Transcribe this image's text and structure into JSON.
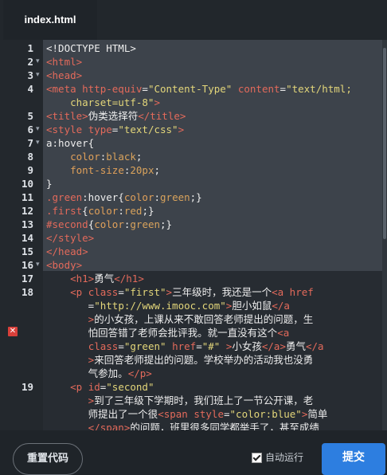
{
  "tab": {
    "label": "index.html"
  },
  "lines": [
    {
      "num": "1",
      "fold": "",
      "segs": [
        [
          "w",
          "<!DOCTYPE HTML>"
        ]
      ]
    },
    {
      "num": "2",
      "fold": "▾",
      "segs": [
        [
          "t",
          "<html>"
        ]
      ]
    },
    {
      "num": "3",
      "fold": "▾",
      "segs": [
        [
          "t",
          "<head>"
        ]
      ]
    },
    {
      "num": "4",
      "fold": "",
      "segs": [
        [
          "t",
          "<meta "
        ],
        [
          "a",
          "http-equiv"
        ],
        [
          "w",
          "="
        ],
        [
          "s",
          "\"Content-Type\""
        ],
        [
          "w",
          " "
        ],
        [
          "a",
          "content"
        ],
        [
          "w",
          "="
        ],
        [
          "s",
          "\"text/html;"
        ]
      ]
    },
    {
      "num": "",
      "fold": "",
      "segs": [
        [
          "s",
          "    charset=utf-8\""
        ],
        [
          "t",
          ">"
        ]
      ]
    },
    {
      "num": "5",
      "fold": "",
      "segs": [
        [
          "t",
          "<title>"
        ],
        [
          "w",
          "伪类选择符"
        ],
        [
          "t",
          "</title>"
        ]
      ]
    },
    {
      "num": "6",
      "fold": "▾",
      "segs": [
        [
          "t",
          "<style "
        ],
        [
          "a",
          "type"
        ],
        [
          "w",
          "="
        ],
        [
          "s",
          "\"text/css\""
        ],
        [
          "t",
          ">"
        ]
      ]
    },
    {
      "num": "7",
      "fold": "▾",
      "segs": [
        [
          "w",
          "a:hover{"
        ]
      ]
    },
    {
      "num": "8",
      "fold": "",
      "segs": [
        [
          "w",
          "    "
        ],
        [
          "p",
          "color"
        ],
        [
          "w",
          ":"
        ],
        [
          "n",
          "black"
        ],
        [
          "w",
          ";"
        ]
      ]
    },
    {
      "num": "9",
      "fold": "",
      "segs": [
        [
          "w",
          "    "
        ],
        [
          "p",
          "font-size"
        ],
        [
          "w",
          ":"
        ],
        [
          "n",
          "20px"
        ],
        [
          "w",
          ";"
        ]
      ]
    },
    {
      "num": "10",
      "fold": "",
      "segs": [
        [
          "w",
          "}"
        ]
      ]
    },
    {
      "num": "11",
      "fold": "",
      "segs": [
        [
          "t",
          ".green"
        ],
        [
          "w",
          ":hover{"
        ],
        [
          "p",
          "color"
        ],
        [
          "w",
          ":"
        ],
        [
          "n",
          "green"
        ],
        [
          "w",
          ";}"
        ]
      ]
    },
    {
      "num": "12",
      "fold": "",
      "segs": [
        [
          "t",
          ".first"
        ],
        [
          "w",
          "{"
        ],
        [
          "p",
          "color"
        ],
        [
          "w",
          ":"
        ],
        [
          "n",
          "red"
        ],
        [
          "w",
          ";}"
        ]
      ]
    },
    {
      "num": "13",
      "fold": "",
      "segs": [
        [
          "t",
          "#second"
        ],
        [
          "w",
          "{"
        ],
        [
          "p",
          "color"
        ],
        [
          "w",
          ":"
        ],
        [
          "n",
          "green"
        ],
        [
          "w",
          ";}"
        ]
      ]
    },
    {
      "num": "14",
      "fold": "",
      "segs": [
        [
          "t",
          "</style>"
        ]
      ]
    },
    {
      "num": "15",
      "fold": "",
      "segs": [
        [
          "t",
          "</head>"
        ]
      ]
    },
    {
      "num": "16",
      "fold": "▾",
      "segs": [
        [
          "t",
          "<body>"
        ]
      ]
    },
    {
      "num": "17",
      "fold": "",
      "segs": [
        [
          "w",
          "    "
        ],
        [
          "t",
          "<h1>"
        ],
        [
          "w",
          "勇气"
        ],
        [
          "t",
          "</h1>"
        ]
      ]
    },
    {
      "num": "18",
      "fold": "",
      "segs": [
        [
          "w",
          "    "
        ],
        [
          "t",
          "<p "
        ],
        [
          "a",
          "class"
        ],
        [
          "w",
          "="
        ],
        [
          "s",
          "\"first\""
        ],
        [
          "t",
          ">"
        ],
        [
          "w",
          "三年级时，我还是一个"
        ],
        [
          "t",
          "<a "
        ],
        [
          "a",
          "href"
        ]
      ]
    },
    {
      "num": "",
      "fold": "",
      "segs": [
        [
          "w",
          "       ="
        ],
        [
          "s",
          "\"http://www.imooc.com\""
        ],
        [
          "t",
          ">"
        ],
        [
          "w",
          "胆小如鼠"
        ],
        [
          "t",
          "</a"
        ]
      ]
    },
    {
      "num": "",
      "fold": "",
      "segs": [
        [
          "t",
          "       >"
        ],
        [
          "w",
          "的小女孩，上课从来不敢回答老师提出的问题，生"
        ]
      ]
    },
    {
      "num": "",
      "fold": "",
      "segs": [
        [
          "w",
          "       怕回答错了老师会批评我。就一直没有这个"
        ],
        [
          "t",
          "<a"
        ]
      ]
    },
    {
      "num": "",
      "fold": "",
      "segs": [
        [
          "w",
          "       "
        ],
        [
          "a",
          "class"
        ],
        [
          "w",
          "="
        ],
        [
          "s",
          "\"green\""
        ],
        [
          "w",
          " "
        ],
        [
          "a",
          "href"
        ],
        [
          "w",
          "="
        ],
        [
          "s",
          "\"#\""
        ],
        [
          "w",
          " "
        ],
        [
          "t",
          ">"
        ],
        [
          "w",
          "小女孩"
        ],
        [
          "t",
          "</a>"
        ],
        [
          "w",
          "勇气"
        ],
        [
          "t",
          "</a"
        ]
      ]
    },
    {
      "num": "",
      "fold": "",
      "segs": [
        [
          "t",
          "       >"
        ],
        [
          "w",
          "来回答老师提出的问题。学校举办的活动我也没勇"
        ]
      ]
    },
    {
      "num": "",
      "fold": "",
      "segs": [
        [
          "w",
          "       气参加。"
        ],
        [
          "t",
          "</p>"
        ]
      ]
    },
    {
      "num": "19",
      "fold": "",
      "segs": [
        [
          "w",
          "    "
        ],
        [
          "t",
          "<p "
        ],
        [
          "a",
          "id"
        ],
        [
          "w",
          "="
        ],
        [
          "s",
          "\"second\""
        ]
      ]
    },
    {
      "num": "",
      "fold": "",
      "segs": [
        [
          "t",
          "       >"
        ],
        [
          "w",
          "到了三年级下学期时，我们班上了一节公开课，老"
        ]
      ]
    },
    {
      "num": "",
      "fold": "",
      "segs": [
        [
          "w",
          "       师提出了一个很"
        ],
        [
          "t",
          "<span "
        ],
        [
          "a",
          "style"
        ],
        [
          "w",
          "="
        ],
        [
          "s",
          "\"color:blue\""
        ],
        [
          "t",
          ">"
        ],
        [
          "w",
          "简单"
        ]
      ]
    },
    {
      "num": "",
      "fold": "",
      "segs": [
        [
          "t",
          "       </span>"
        ],
        [
          "w",
          "的问题，班里很多同学都举手了，甚至成绩"
        ]
      ]
    }
  ],
  "footer": {
    "reset_label": "重置代码",
    "auto_run_label": "自动运行",
    "submit_label": "提交"
  },
  "colors": {
    "tag": "#e36a5b",
    "string": "#e3d67a",
    "property": "#e0a05a",
    "text": "#ededed",
    "submit": "#2d7ee0",
    "error": "#d9403a"
  },
  "icons": {
    "fold": "chevron-down-icon",
    "error": "error-x-icon"
  }
}
